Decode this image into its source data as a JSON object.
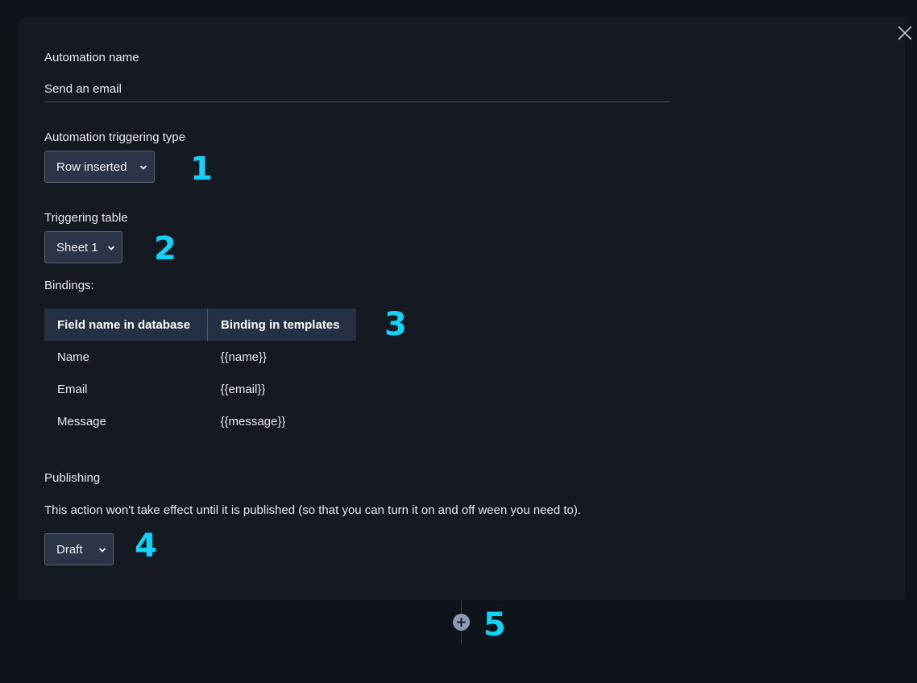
{
  "form": {
    "automation_name_label": "Automation name",
    "automation_name_value": "Send an email",
    "trigger_type_label": "Automation triggering type",
    "trigger_type_selected": "Row inserted",
    "triggering_table_label": "Triggering table",
    "triggering_table_selected": "Sheet 1",
    "bindings_label": "Bindings:",
    "publishing_label": "Publishing",
    "publishing_note": "This action won't take effect until it is published (so that you can turn it on and off ween you need to).",
    "publishing_selected": "Draft"
  },
  "bindings_table": {
    "headers": [
      "Field name in database",
      "Binding in templates"
    ],
    "rows": [
      [
        "Name",
        "{{name}}"
      ],
      [
        "Email",
        "{{email}}"
      ],
      [
        "Message",
        "{{message}}"
      ]
    ]
  },
  "annotations": [
    "1",
    "2",
    "3",
    "4",
    "5"
  ],
  "icons": {
    "close": "close-icon",
    "chevron": "chevron-down-icon",
    "add": "plus-circle-icon"
  },
  "colors": {
    "background": "#0f131a",
    "panel": "#141922",
    "select_bg": "#2b3547",
    "table_header_bg": "#263044",
    "annotation": "#12d3f5"
  }
}
